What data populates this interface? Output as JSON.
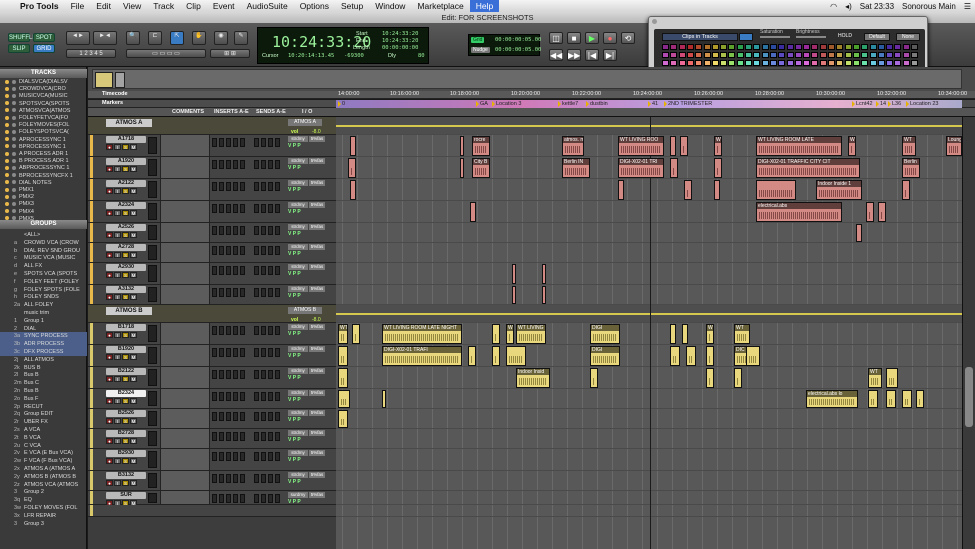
{
  "menubar": {
    "app": "Pro Tools",
    "items": [
      "File",
      "Edit",
      "View",
      "Track",
      "Clip",
      "Event",
      "AudioSuite",
      "Options",
      "Setup",
      "Window",
      "Marketplace",
      "Help"
    ],
    "clock": "Sat 23:33",
    "user": "Sonorous Main"
  },
  "window_title": "Edit: FOR SCREENSHOTS",
  "toolbar": {
    "modes": [
      "SHUFFLE",
      "SPOT",
      "SLIP",
      "GRID"
    ],
    "counter_main": "10:24:33:20",
    "counter_cursor_label": "Cursor",
    "counter_cursor": "10:20:14:13.45",
    "counter_sub": "-69300",
    "start_label": "Start",
    "end_label": "End",
    "length_label": "Length",
    "start": "10:24:33:20",
    "end": "10:24:33:20",
    "length": "00:00:00:00",
    "dly_label": "Dly",
    "dly_val": "80",
    "grid_label": "Grid",
    "nudge_label": "Nudge",
    "grid_val": "00:00:00:05.00",
    "nudge_val": "00:00:00:05.00"
  },
  "color_palette": {
    "selector": "Clips in Tracks",
    "saturation": "Saturation",
    "brightness": "Brightness",
    "hold": "HOLD",
    "default": "Default",
    "none": "None",
    "row1": [
      "#8a2a8a",
      "#a02a7a",
      "#b02858",
      "#b02a2a",
      "#b04a2a",
      "#b0722a",
      "#b09a2a",
      "#8aa02a",
      "#5aa02a",
      "#2aa04a",
      "#2aa07a",
      "#2a9aa0",
      "#2a72a0",
      "#2a4aa0",
      "#3a2aa0",
      "#5a2aa0",
      "#7a2aa0",
      "#9a2a9a",
      "#a02a6a",
      "#a03a3a",
      "#a05a2a",
      "#a0822a",
      "#82a02a",
      "#4aa02a",
      "#2aa06a",
      "#2a8aa0",
      "#2a5aa0",
      "#4a2aa0",
      "#6a2aa0",
      "#8a2a8a",
      "#5a5a5a"
    ],
    "row2": [
      "#b04ab0",
      "#c04a9a",
      "#d04a78",
      "#d04a4a",
      "#d06a4a",
      "#d0924a",
      "#d0ba4a",
      "#aac04a",
      "#7ac04a",
      "#4ac06a",
      "#4ac09a",
      "#4abac0",
      "#4a92c0",
      "#4a6ac0",
      "#5a4ac0",
      "#7a4ac0",
      "#9a4ac0",
      "#ba4aba",
      "#c04a8a",
      "#c05a5a",
      "#c07a4a",
      "#c0a24a",
      "#a2c04a",
      "#6ac04a",
      "#4ac08a",
      "#4aaac0",
      "#4a7ac0",
      "#6a4ac0",
      "#8a4ac0",
      "#aa4aaa",
      "#7a7a7a"
    ],
    "row3": [
      "#d06ad0",
      "#e06aba",
      "#f06a98",
      "#f06a6a",
      "#f08a6a",
      "#f0b26a",
      "#f0da6a",
      "#cae06a",
      "#9ae06a",
      "#6ae08a",
      "#6ae0ba",
      "#6adae0",
      "#6ab2e0",
      "#6a8ae0",
      "#7a6ae0",
      "#9a6ae0",
      "#ba6ae0",
      "#da6ada",
      "#e06aaa",
      "#e07a7a",
      "#e09a6a",
      "#e0c26a",
      "#c2e06a",
      "#8ae06a",
      "#6ae0aa",
      "#6acae0",
      "#6a9ae0",
      "#8a6ae0",
      "#aa6ae0",
      "#ca6aca",
      "#9a9a9a"
    ]
  },
  "sidebar": {
    "tracks_header": "TRACKS",
    "tracks": [
      "DIALSVCA(DIALSV",
      "CROWDVCA(CRO",
      "MUSICVCA(MUSIC",
      "SPOTSVCA(SPOTS",
      "ATMOSVCA(ATMOS",
      "FOLEYFETVCA(FO",
      "FOLEYMOVES(FOL",
      "FOLEYSPOTSVCA(",
      "APROCESSYNC 1",
      "BPROCESSYNC 1",
      "A PROCESS ADR 1",
      "B PROCESS ADR 1",
      "ABPROCESSYNC 1",
      "BPROCESSYNCFX 1",
      "DIAL NOTES",
      "PMX1",
      "PMX2",
      "PMX3",
      "PMX4",
      "PMX5"
    ],
    "groups_header": "GROUPS",
    "groups": [
      "<ALL>",
      "CROWD VCA (CROW",
      "DIAL REV SND GROU",
      "MUSIC VCA (MUSIC",
      "ALL FX",
      "SPOTS VCA (SPOTS",
      "FOLEY FEET (FOLEY",
      "FOLEY SPOTS (FOLE",
      "FOLEY SNDS",
      "ALL FOLEY",
      "music trim",
      "Group 1",
      "DIAL",
      "SYNC PROCESS",
      "ADR PROCESS",
      "DFX PROCESS",
      "ALL ATMOS",
      "BUS B",
      "Bus B",
      "Bus C",
      "Bus B",
      "Bus F",
      "RECUT",
      "Group EDIT",
      "UBER FX",
      "A VCA",
      "B VCA",
      "C VCA",
      "E VCA (E Bus VCA)",
      "F VCA (F Bus VCA)",
      "ATMOS A (ATMOS A",
      "ATMOS B (ATMOS B",
      "ATMOS VCA (ATMOS",
      "Group 2",
      "EQ",
      "FOLEY MOVES (FOL",
      "LFR REPAIR",
      "Group 3"
    ],
    "group_ids": [
      "",
      "a",
      "b",
      "c",
      "d",
      "e",
      "f",
      "g",
      "h",
      "2a",
      "",
      "1",
      "2",
      "3a",
      "3b",
      "3c",
      "2j",
      "2k",
      "2l",
      "2m",
      "2n",
      "2o",
      "2p",
      "2q",
      "2r",
      "2s",
      "2t",
      "2u",
      "2v",
      "2w",
      "2x",
      "2y",
      "2z",
      "3",
      "3q",
      "3w",
      "3x",
      "3"
    ]
  },
  "rulers": {
    "timecode_label": "Timecode",
    "markers_label": "Markers",
    "ticks": [
      "14:00:00",
      "10:16:00:00",
      "10:18:00:00",
      "10:20:00:00",
      "10:22:00:00",
      "10:24:00:00",
      "10:26:00:00",
      "10:28:00:00",
      "10:30:00:00",
      "10:32:00:00",
      "10:34:00:00"
    ],
    "markers": [
      "GA",
      "Location 3",
      "kettle7",
      "dustbin",
      "41",
      "2ND TRIMESTER",
      "Lcnt42",
      "14",
      "L36",
      "Location 23",
      "0"
    ]
  },
  "columns": {
    "comments": "COMMENTS",
    "inserts": "INSERTS A-E",
    "sends": "SENDS A-E",
    "io": "I / O"
  },
  "tracks": [
    {
      "name": "ATMOS A",
      "kind": "vca",
      "io": "ATMOS A",
      "vol": "vol",
      "db": "-8.0"
    },
    {
      "name": "A1718",
      "io": "strdmy",
      "io2": "5%fas"
    },
    {
      "name": "A1920",
      "io": "strdmy",
      "io2": "5%fas"
    },
    {
      "name": "A2122",
      "io": "strdmy",
      "io2": "5%fas"
    },
    {
      "name": "A2324",
      "io": "strdmy",
      "io2": "5%fas"
    },
    {
      "name": "A2526",
      "io": "strdmy",
      "io2": "5%fas"
    },
    {
      "name": "A2728",
      "io": "strdmy",
      "io2": "5%fas"
    },
    {
      "name": "A2930",
      "io": "strdmy",
      "io2": "5%fas"
    },
    {
      "name": "A3132",
      "io": "strdmy",
      "io2": "5%fas"
    },
    {
      "name": "ATMOS B",
      "kind": "vca",
      "io": "ATMOS B",
      "vol": "vol",
      "db": "-8.0"
    },
    {
      "name": "B1718",
      "io": "strdmy",
      "io2": "5%fas"
    },
    {
      "name": "B1920",
      "io": "strdmy",
      "io2": "5%fas"
    },
    {
      "name": "B2122",
      "io": "strdmy",
      "io2": "5%fas"
    },
    {
      "name": "B2324",
      "io": "strdmy",
      "io2": "5%fas"
    },
    {
      "name": "B2526",
      "io": "strdmy",
      "io2": "5%fas"
    },
    {
      "name": "B2728",
      "io": "strdmy",
      "io2": "5%fas"
    },
    {
      "name": "B2930",
      "io": "strdmy",
      "io2": "5%fas"
    },
    {
      "name": "B3132",
      "io": "strdmy",
      "io2": "5%fas"
    },
    {
      "name": "SUR",
      "io": "surdmy",
      "io2": "5%fas"
    },
    {
      "name": "",
      "io": "",
      "io2": ""
    }
  ],
  "clip_labels": {
    "a1718": [
      "rocre",
      "atmos. m",
      "WT LIVING ROO",
      "WT LIVING ROOM LATE",
      "WT LI",
      "WT",
      "Loung"
    ],
    "a1920": [
      "City B",
      "Berlin IN",
      "DIGI-X02-01 TRI",
      "DIGI-X02-01 TRAFFIC CITY CIT",
      "Berlin"
    ],
    "a2122": [
      "Indoor Inside 1"
    ],
    "a2324": [
      "electrical.abs"
    ],
    "b1718": [
      "WT",
      "WT LIVING ROOM LATE NIGHT",
      "WT LIVING",
      "DIGI",
      "WT"
    ],
    "b1920": [
      "DIGI-X02-01 TRAFI",
      "DIGI",
      "DIC"
    ],
    "b2122": [
      "Indoor Insid",
      "WT"
    ],
    "b2324": [
      "electrical.abs lo"
    ]
  }
}
